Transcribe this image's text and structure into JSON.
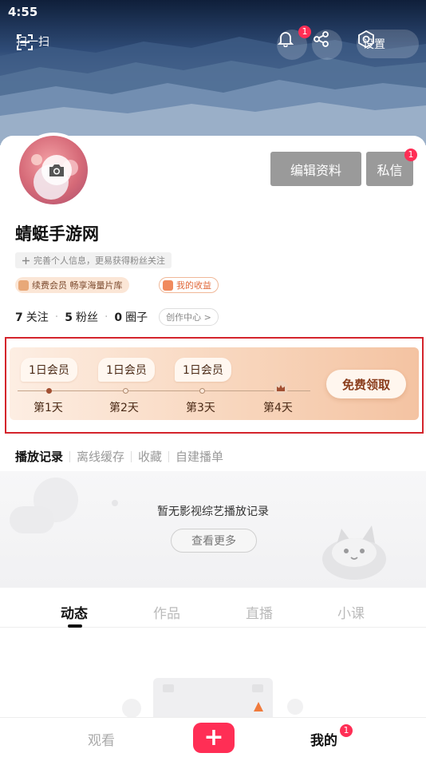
{
  "status_bar": {
    "time": "4:55"
  },
  "header": {
    "scan_label": "扫一扫",
    "notification_badge": "1",
    "settings_label": "设置"
  },
  "profile": {
    "edit_button": "编辑资料",
    "message_button": "私信",
    "message_badge": "1",
    "username": "蜻蜓手游网",
    "complete_tip": "完善个人信息，更易获得粉丝关注",
    "vip_chip": "续费会员 畅享海量片库",
    "earnings_chip": "我的收益",
    "stats": {
      "following_count": "7",
      "following_label": "关注",
      "fans_count": "5",
      "fans_label": "粉丝",
      "circles_count": "0",
      "circles_label": "圈子"
    },
    "creator_center": "创作中心 >"
  },
  "member_card": {
    "days": [
      {
        "reward": "1日会员",
        "label": "第1天"
      },
      {
        "reward": "1日会员",
        "label": "第2天"
      },
      {
        "reward": "1日会员",
        "label": "第3天"
      },
      {
        "reward": "",
        "label": "第4天"
      }
    ],
    "claim_button": "免费领取"
  },
  "history": {
    "tabs": [
      "播放记录",
      "离线缓存",
      "收藏",
      "自建播单"
    ],
    "empty_text": "暂无影视综艺播放记录",
    "see_more": "查看更多"
  },
  "content_tabs": [
    "动态",
    "作品",
    "直播",
    "小课"
  ],
  "bottom_nav": {
    "watch": "观看",
    "create": "+",
    "mine": "我的",
    "mine_badge": "1"
  },
  "colors": {
    "accent_red": "#ff2e55",
    "frame_red": "#d4242c",
    "gray_button": "#9a9a9a"
  }
}
